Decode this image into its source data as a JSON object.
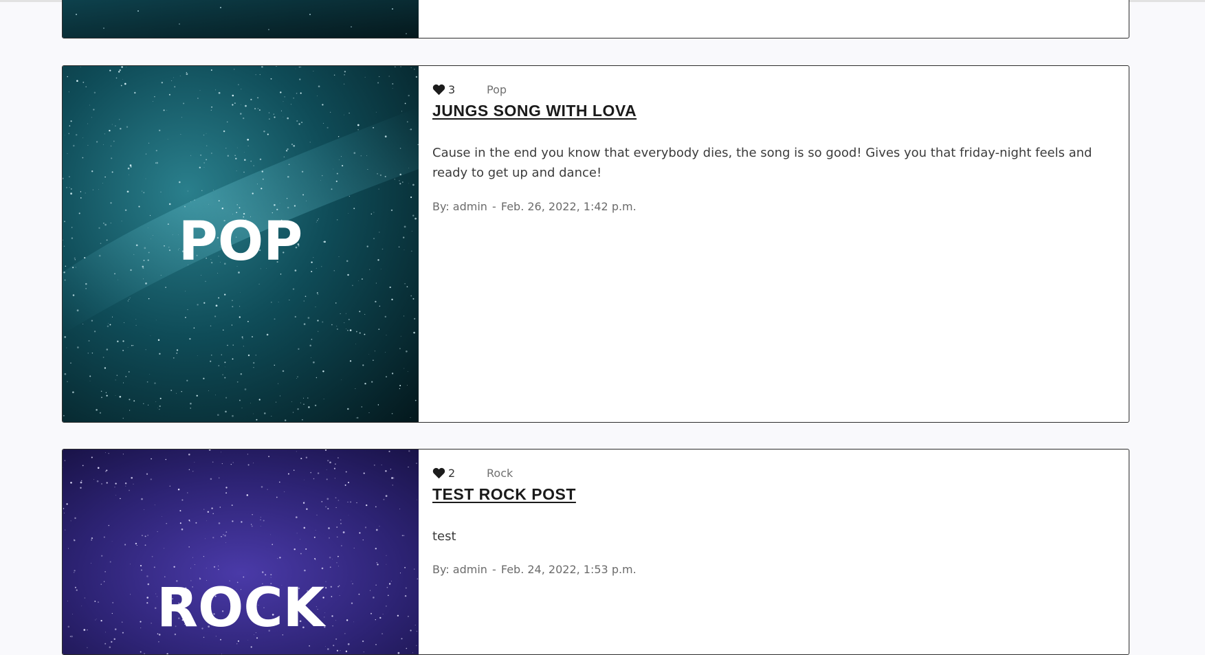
{
  "posts": [
    {
      "image_word": "",
      "image_palette": [
        "#0b3a40",
        "#072128"
      ],
      "likes": "",
      "category": "",
      "title": "",
      "excerpt": "",
      "author_prefix": "",
      "author": "",
      "date": ""
    },
    {
      "image_word": "POP",
      "image_palette": [
        "#1d6b7a",
        "#06222a"
      ],
      "likes": "3",
      "category": "Pop",
      "title": "JUNGS SONG WITH LOVA",
      "excerpt": "Cause in the end you know that everybody dies, the song is so good! Gives you that friday-night feels and ready to get up and dance!",
      "author_prefix": "By:",
      "author": "admin",
      "separator": "-",
      "date": "Feb. 26, 2022, 1:42 p.m."
    },
    {
      "image_word": "ROCK",
      "image_palette": [
        "#3b2f8f",
        "#140f3e"
      ],
      "likes": "2",
      "category": "Rock",
      "title": "TEST ROCK POST",
      "excerpt": "test",
      "author_prefix": "By:",
      "author": "admin",
      "separator": "-",
      "date": "Feb. 24, 2022, 1:53 p.m."
    }
  ],
  "colors": {
    "background": "#f9f9fc",
    "card_border": "#2b2b2b",
    "text": "#3b3b3b",
    "muted": "#6b6b6b"
  }
}
